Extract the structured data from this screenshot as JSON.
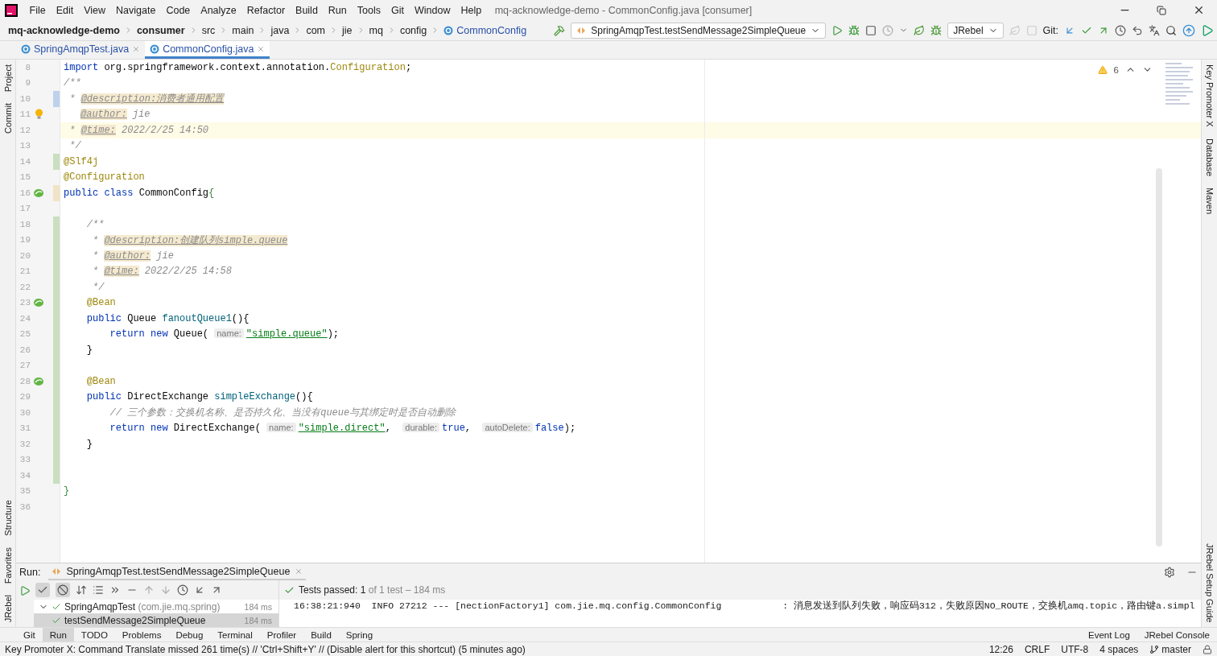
{
  "menu_bar": {
    "items": [
      "File",
      "Edit",
      "View",
      "Navigate",
      "Code",
      "Analyze",
      "Refactor",
      "Build",
      "Run",
      "Tools",
      "Git",
      "Window",
      "Help"
    ],
    "title": "mq-acknowledge-demo - CommonConfig.java [consumer]"
  },
  "breadcrumbs": [
    {
      "label": "mq-acknowledge-demo",
      "kind": "module"
    },
    {
      "label": "consumer",
      "kind": "module"
    },
    {
      "label": "src",
      "kind": "dir"
    },
    {
      "label": "main",
      "kind": "dir"
    },
    {
      "label": "java",
      "kind": "dir"
    },
    {
      "label": "com",
      "kind": "dir"
    },
    {
      "label": "jie",
      "kind": "dir"
    },
    {
      "label": "mq",
      "kind": "dir"
    },
    {
      "label": "config",
      "kind": "dir"
    },
    {
      "label": "CommonConfig",
      "kind": "class"
    }
  ],
  "toolbar": {
    "run_config": "SpringAmqpTest.testSendMessage2SimpleQueue",
    "jrebel": "JRebel",
    "git_label": "Git:"
  },
  "tabs": [
    {
      "label": "SpringAmqpTest.java",
      "selected": false
    },
    {
      "label": "CommonConfig.java",
      "selected": true
    }
  ],
  "left_tool_windows": {
    "top": [
      "Project",
      "Commit"
    ],
    "bottom": [
      "Structure",
      "Favorites",
      "JRebel"
    ]
  },
  "right_tool_windows": {
    "top": [
      "Key Promoter X",
      "Database",
      "Maven"
    ],
    "bottom": [
      "JRebel Setup Guide"
    ]
  },
  "editor": {
    "warnings": "6",
    "lines": [
      {
        "num": "8",
        "current": false,
        "tokens": [
          {
            "kind": "kw",
            "text": "import "
          },
          {
            "kind": "plain",
            "text": "org.springframework.context.annotation."
          },
          {
            "kind": "ann",
            "text": "Configuration"
          },
          {
            "kind": "plain",
            "text": ";"
          }
        ]
      },
      {
        "num": "9",
        "current": false,
        "tokens": [
          {
            "kind": "comment",
            "text": "/**"
          }
        ]
      },
      {
        "num": "10",
        "color": "#bcd2ec",
        "current": false,
        "tokens": [
          {
            "kind": "comment",
            "text": " * "
          },
          {
            "kind": "doctag",
            "text": "@description:消费者通用配置"
          }
        ]
      },
      {
        "num": "11",
        "current": false,
        "gutter": {
          "kind": "bulb"
        },
        "tokens": [
          {
            "kind": "doctag",
            "text": "@author:"
          },
          {
            "kind": "comment",
            "text": " jie"
          }
        ]
      },
      {
        "num": "12",
        "current": true,
        "tokens": [
          {
            "kind": "comment",
            "text": " * "
          },
          {
            "kind": "doctag",
            "text": "@time:"
          },
          {
            "kind": "comment",
            "text": " 2022/2/25 14:50"
          }
        ]
      },
      {
        "num": "13",
        "current": false,
        "tokens": [
          {
            "kind": "comment",
            "text": " */"
          }
        ]
      },
      {
        "num": "14",
        "color": "#c9dfc0",
        "current": false,
        "tokens": [
          {
            "kind": "ann",
            "text": "@Slf4j"
          }
        ]
      },
      {
        "num": "15",
        "current": false,
        "tokens": [
          {
            "kind": "ann",
            "text": "@Configuration"
          }
        ]
      },
      {
        "num": "16",
        "color": "#f1e4c6",
        "current": false,
        "gutter": {
          "kind": "bean"
        },
        "tokens": [
          {
            "kind": "kw",
            "text": "public class "
          },
          {
            "kind": "plain",
            "text": "CommonConfig"
          },
          {
            "kind": "brace",
            "text": "{"
          }
        ]
      },
      {
        "num": "17",
        "current": false
      },
      {
        "num": "18",
        "color": "#c9dfc0",
        "current": false,
        "tokens": [
          {
            "kind": "comment",
            "text": "    /**"
          }
        ]
      },
      {
        "num": "19",
        "color": "#c9dfc0",
        "current": false,
        "tokens": [
          {
            "kind": "comment",
            "text": "     * "
          },
          {
            "kind": "doctag",
            "text": "@description:创建队列simple.queue"
          }
        ]
      },
      {
        "num": "20",
        "color": "#c9dfc0",
        "current": false,
        "tokens": [
          {
            "kind": "comment",
            "text": "     * "
          },
          {
            "kind": "doctag",
            "text": "@author:"
          },
          {
            "kind": "comment",
            "text": " jie"
          }
        ]
      },
      {
        "num": "21",
        "color": "#c9dfc0",
        "current": false,
        "tokens": [
          {
            "kind": "comment",
            "text": "     * "
          },
          {
            "kind": "doctag",
            "text": "@time:"
          },
          {
            "kind": "comment",
            "text": " 2022/2/25 14:58"
          }
        ]
      },
      {
        "num": "22",
        "color": "#c9dfc0",
        "current": false,
        "tokens": [
          {
            "kind": "comment",
            "text": "     */"
          }
        ]
      },
      {
        "num": "23",
        "color": "#c9dfc0",
        "current": false,
        "gutter": {
          "kind": "bean"
        },
        "tokens": [
          {
            "kind": "ann",
            "text": "    @Bean"
          }
        ]
      },
      {
        "num": "24",
        "color": "#c9dfc0",
        "current": false,
        "tokens": [
          {
            "kind": "kw",
            "text": "    public "
          },
          {
            "kind": "plain",
            "text": "Queue "
          },
          {
            "kind": "method",
            "text": "fanoutQueue1"
          },
          {
            "kind": "plain",
            "text": "(){"
          }
        ]
      },
      {
        "num": "25",
        "color": "#c9dfc0",
        "current": false,
        "tokens": [
          {
            "kind": "kw",
            "text": "        return new "
          },
          {
            "kind": "plain",
            "text": "Queue( "
          },
          {
            "kind": "hint",
            "text": "name:"
          },
          {
            "kind": "str",
            "text": "\"simple.queue\""
          },
          {
            "kind": "plain",
            "text": ");"
          }
        ]
      },
      {
        "num": "26",
        "color": "#c9dfc0",
        "current": false,
        "tokens": [
          {
            "kind": "plain",
            "text": "    }"
          }
        ]
      },
      {
        "num": "27",
        "color": "#c9dfc0",
        "current": false
      },
      {
        "num": "28",
        "color": "#c9dfc0",
        "current": false,
        "gutter": {
          "kind": "bean"
        },
        "tokens": [
          {
            "kind": "ann",
            "text": "    @Bean"
          }
        ]
      },
      {
        "num": "29",
        "color": "#c9dfc0",
        "current": false,
        "tokens": [
          {
            "kind": "kw",
            "text": "    public "
          },
          {
            "kind": "plain",
            "text": "DirectExchange "
          },
          {
            "kind": "method",
            "text": "simpleExchange"
          },
          {
            "kind": "plain",
            "text": "(){"
          }
        ]
      },
      {
        "num": "30",
        "color": "#c9dfc0",
        "current": false,
        "tokens": [
          {
            "kind": "comment",
            "text": "        // 三个参数：交换机名称、是否持久化、当没有queue与其绑定时是否自动删除"
          }
        ]
      },
      {
        "num": "31",
        "color": "#c9dfc0",
        "current": false,
        "tokens": [
          {
            "kind": "kw",
            "text": "        return new "
          },
          {
            "kind": "plain",
            "text": "DirectExchange( "
          },
          {
            "kind": "hint",
            "text": "name:"
          },
          {
            "kind": "str",
            "text": "\"simple.direct\""
          },
          {
            "kind": "plain",
            "text": ",  "
          },
          {
            "kind": "hint",
            "text": "durable:"
          },
          {
            "kind": "kw",
            "text": "true"
          },
          {
            "kind": "plain",
            "text": ",  "
          },
          {
            "kind": "hint",
            "text": "autoDelete:"
          },
          {
            "kind": "kw",
            "text": "false"
          },
          {
            "kind": "plain",
            "text": ");"
          }
        ]
      },
      {
        "num": "32",
        "color": "#c9dfc0",
        "current": false,
        "tokens": [
          {
            "kind": "plain",
            "text": "    }"
          }
        ]
      },
      {
        "num": "33",
        "color": "#c9dfc0",
        "current": false
      },
      {
        "num": "34",
        "color": "#c9dfc0",
        "current": false
      },
      {
        "num": "35",
        "current": false,
        "tokens": [
          {
            "kind": "brace",
            "text": "}"
          }
        ]
      },
      {
        "num": "36",
        "current": false
      }
    ]
  },
  "run_panel": {
    "label": "Run:",
    "tab": "SpringAmqpTest.testSendMessage2SimpleQueue",
    "status": "Tests passed:",
    "passed_count": "1",
    "summary": "of 1 test – 184 ms",
    "tree": [
      {
        "label": "SpringAmqpTest",
        "detail": "(com.jie.mq.spring)",
        "time": "184 ms",
        "expanded": true,
        "children": [
          {
            "label": "testSendMessage2SimpleQueue",
            "time": "184 ms"
          }
        ]
      }
    ],
    "console": [
      "16:38:21:940  INFO 27212 --- [nectionFactory1] com.jie.mq.config.CommonConfig           : 消息发送到队列失败，响应码312，失败原因NO_ROUTE，交换机amq.topic，路由键a.simpl"
    ]
  },
  "tool_strip": [
    {
      "label": "Git",
      "selected": false
    },
    {
      "label": "Run",
      "selected": true
    },
    {
      "label": "TODO",
      "selected": false
    },
    {
      "label": "Problems",
      "selected": false
    },
    {
      "label": "Debug",
      "selected": false
    },
    {
      "label": "Terminal",
      "selected": false
    },
    {
      "label": "Profiler",
      "selected": false
    },
    {
      "label": "Build",
      "selected": false
    },
    {
      "label": "Spring",
      "selected": false
    }
  ],
  "tool_strip_right": [
    "Event Log",
    "JRebel Console"
  ],
  "status_bar": {
    "message": "Key Promoter X: Command Translate missed 261 time(s) // 'Ctrl+Shift+Y' // (Disable alert for this shortcut) (5 minutes ago)",
    "items": [
      "12:26",
      "CRLF",
      "UTF-8",
      "4 spaces",
      "master"
    ]
  }
}
